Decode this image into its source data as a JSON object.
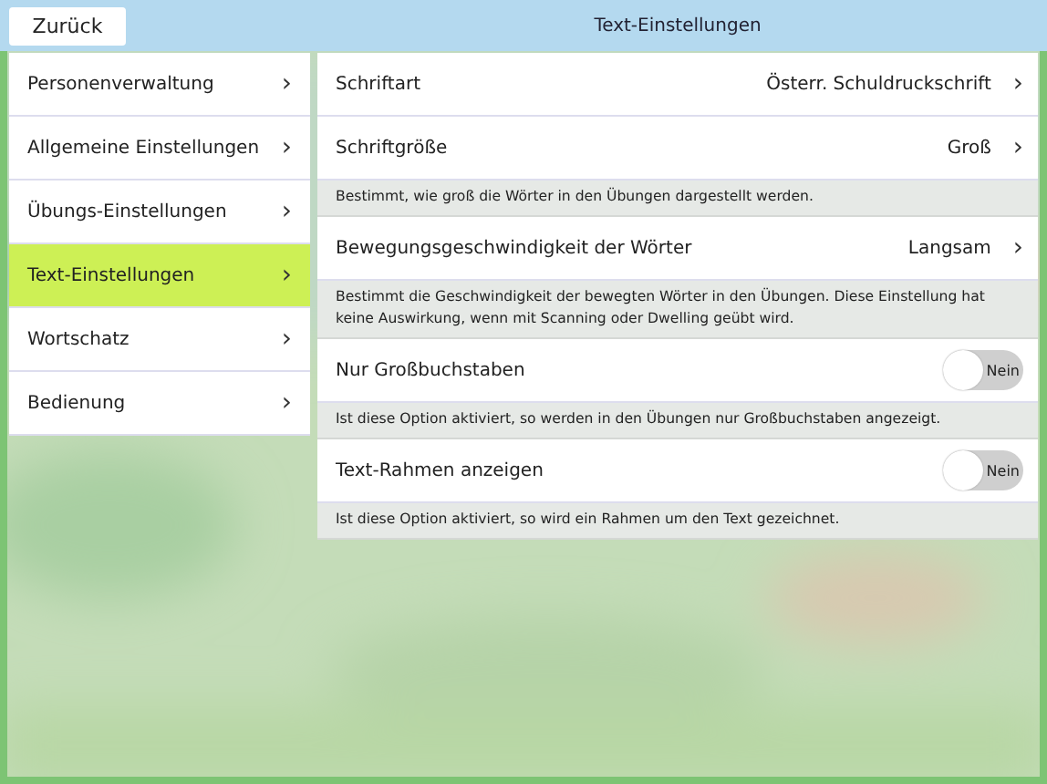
{
  "header": {
    "back_button": "Zurück",
    "title": "Text-Einstellungen"
  },
  "sidebar": {
    "items": [
      {
        "label": "Personenverwaltung",
        "selected": false,
        "chevron": "›"
      },
      {
        "label": "Allgemeine Einstellungen",
        "selected": false,
        "chevron": "›"
      },
      {
        "label": "Übungs-Einstellungen",
        "selected": false,
        "chevron": "›"
      },
      {
        "label": "Text-Einstellungen",
        "selected": true,
        "chevron": "›"
      },
      {
        "label": "Wortschatz",
        "selected": false,
        "chevron": "›"
      },
      {
        "label": "Bedienung",
        "selected": false,
        "chevron": "›"
      }
    ]
  },
  "settings": [
    {
      "kind": "value",
      "label": "Schriftart",
      "value": "Österr. Schuldruckschrift",
      "chevron": "›"
    },
    {
      "kind": "value",
      "label": "Schriftgröße",
      "value": "Groß",
      "chevron": "›"
    },
    {
      "kind": "description",
      "text": "Bestimmt, wie groß die Wörter in den Übungen dargestellt werden."
    },
    {
      "kind": "value",
      "label": "Bewegungsgeschwindigkeit der Wörter",
      "value": "Langsam",
      "chevron": "›"
    },
    {
      "kind": "description",
      "text": "Bestimmt die Geschwindigkeit der bewegten Wörter in den Übungen. Diese Einstellung hat keine Auswirkung, wenn mit Scanning oder Dwelling geübt wird."
    },
    {
      "kind": "toggle",
      "label": "Nur Großbuchstaben",
      "on": false,
      "state_text": "Nein"
    },
    {
      "kind": "description",
      "text": "Ist diese Option aktiviert, so werden in den Übungen nur Großbuchstaben angezeigt."
    },
    {
      "kind": "toggle",
      "label": "Text-Rahmen anzeigen",
      "on": false,
      "state_text": "Nein"
    },
    {
      "kind": "description",
      "text": "Ist diese Option aktiviert, so wird ein Rahmen um den Text gezeichnet."
    }
  ]
}
